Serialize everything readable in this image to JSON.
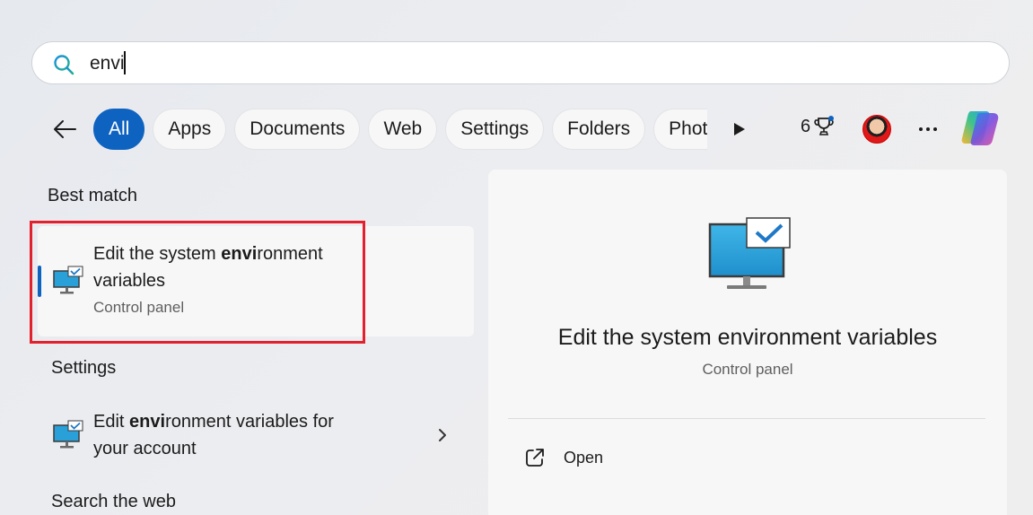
{
  "search": {
    "value": "envi",
    "icon": "search-icon"
  },
  "filters": {
    "chips": [
      "All",
      "Apps",
      "Documents",
      "Web",
      "Settings",
      "Folders",
      "Photos"
    ],
    "active": "All",
    "rewards_count": "6"
  },
  "best_match": {
    "heading": "Best match",
    "title_pre": "Edit the system ",
    "title_bold": "envi",
    "title_post": "ronment",
    "title_line2": "variables",
    "subtitle": "Control panel"
  },
  "settings_section": {
    "heading": "Settings",
    "item_pre": "Edit ",
    "item_bold": "envi",
    "item_post": "ronment variables for",
    "item_line2": "your account"
  },
  "web_section": {
    "heading": "Search the web"
  },
  "preview": {
    "title": "Edit the system environment variables",
    "subtitle": "Control panel",
    "open_label": "Open"
  },
  "colors": {
    "accent": "#0f63c0",
    "highlight": "#e3202e",
    "monitor": "#2aa0d8"
  }
}
